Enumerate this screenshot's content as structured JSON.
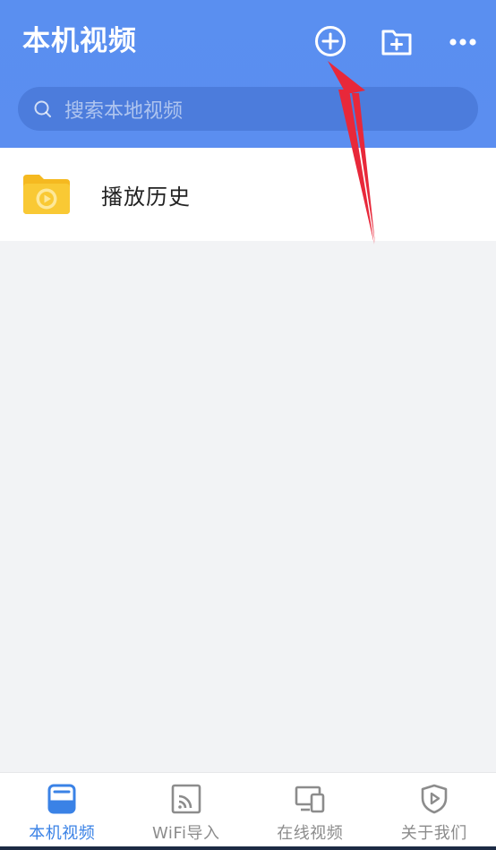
{
  "header": {
    "title": "本机视频",
    "add_icon": "plus-circle-icon",
    "new_folder_icon": "folder-plus-icon",
    "more_icon": "more-dots-icon"
  },
  "search": {
    "placeholder": "搜索本地视频",
    "icon": "search-icon"
  },
  "list": {
    "items": [
      {
        "label": "播放历史",
        "icon": "history-folder-icon"
      }
    ]
  },
  "bottom_nav": {
    "items": [
      {
        "label": "本机视频",
        "icon": "local-storage-icon",
        "active": true
      },
      {
        "label": "WiFi导入",
        "icon": "wifi-cast-icon",
        "active": false
      },
      {
        "label": "在线视频",
        "icon": "devices-icon",
        "active": false
      },
      {
        "label": "关于我们",
        "icon": "shield-play-icon",
        "active": false
      }
    ]
  },
  "colors": {
    "header_bg": "#5b8ef0",
    "accent": "#3a82e6",
    "inactive": "#8c8c8c",
    "folder": "#f7c630",
    "arrow": "#e8283a"
  }
}
